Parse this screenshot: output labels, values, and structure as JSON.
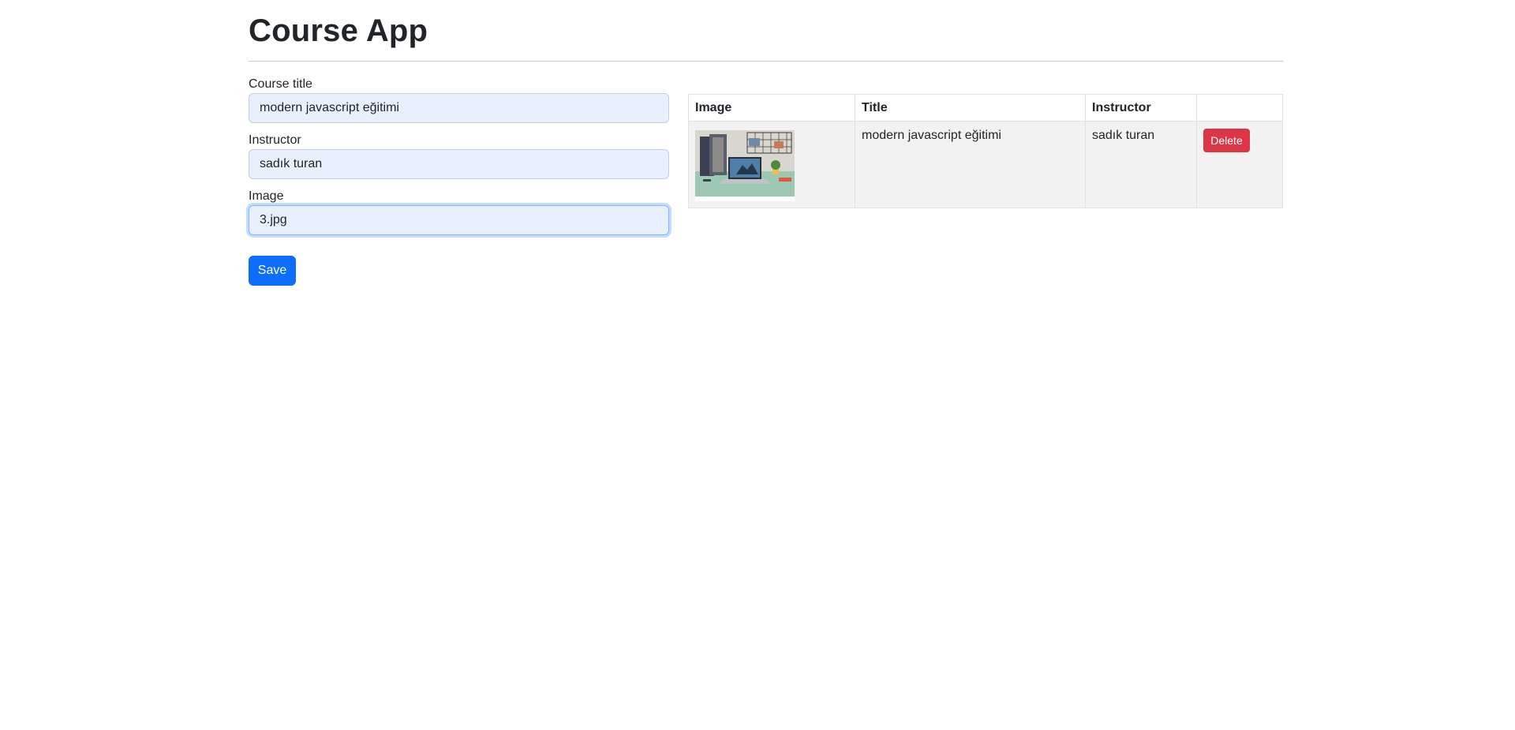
{
  "app": {
    "title": "Course App"
  },
  "form": {
    "course_title": {
      "label": "Course title",
      "value": "modern javascript eğitimi"
    },
    "instructor": {
      "label": "Instructor",
      "value": "sadık turan"
    },
    "image": {
      "label": "Image",
      "value": "3.jpg"
    },
    "save_label": "Save"
  },
  "table": {
    "headers": [
      "Image",
      "Title",
      "Instructor",
      ""
    ],
    "rows": [
      {
        "image_icon": "course-thumbnail-image",
        "title": "modern javascript eğitimi",
        "instructor": "sadık turan",
        "delete_label": "Delete"
      }
    ]
  },
  "colors": {
    "primary": "#0d6efd",
    "danger": "#dc3545",
    "input_autofill_bg": "#e8f0fe",
    "row_bg": "#f2f2f2"
  }
}
